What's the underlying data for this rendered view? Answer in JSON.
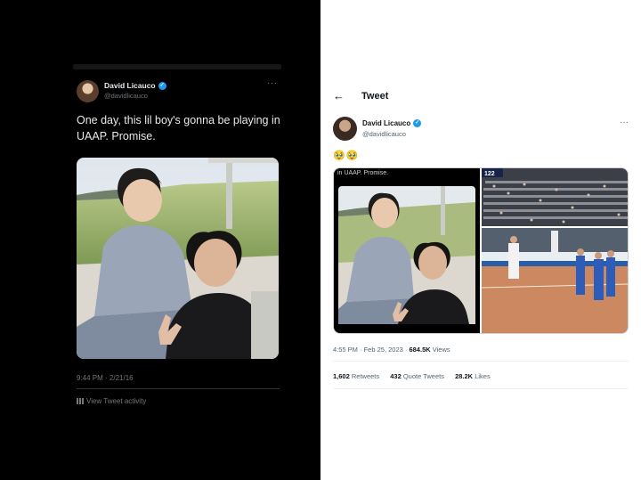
{
  "left_tweet": {
    "name": "David Licauco",
    "handle": "@davidlicauco",
    "more_glyph": "···",
    "text": "One day, this lil boy's gonna be playing in UAAP. Promise.",
    "timestamp": "9:44 PM · 2/21/16",
    "view_activity": "View Tweet activity"
  },
  "right_tweet": {
    "back_glyph": "←",
    "header_title": "Tweet",
    "name": "David Licauco",
    "handle": "@davidlicauco",
    "more_glyph": "···",
    "emoji": "🥹🥹",
    "quoted_caption": "in UAAP. Promise.",
    "scoreboard_text": "122",
    "timestamp": "4:55 PM · Feb 25, 2023 · ",
    "views_count": "684.5K",
    "views_label": " Views",
    "stats": {
      "retweets_count": "1,602",
      "retweets_label": "Retweets",
      "quote_count": "432",
      "quote_label": "Quote Tweets",
      "likes_count": "28.2K",
      "likes_label": "Likes"
    }
  },
  "colors": {
    "dark_bg": "#000000",
    "verified_blue": "#1d9bf0",
    "dark_text": "#e7e9ea",
    "muted": "#71767b",
    "light_text": "#0f1419"
  }
}
